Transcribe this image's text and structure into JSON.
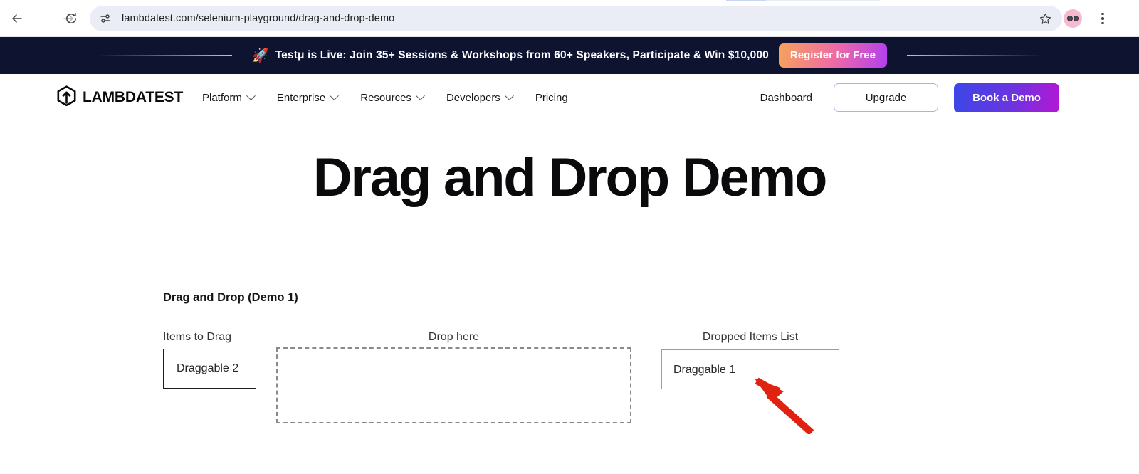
{
  "browser": {
    "back_icon": "arrow-left-icon",
    "forward_icon": "arrow-right-icon",
    "reload_icon": "reload-icon",
    "site_info_icon": "tune-sliders-icon",
    "url": "lambdatest.com/selenium-playground/drag-and-drop-demo",
    "url_placeholder": "Search Google or type a URL",
    "bookmark_icon": "star-icon",
    "avatar_icon": "profile-avatar-icon",
    "menu_icon": "kebab-menu-icon",
    "omnibox_bg": "#eaedf6"
  },
  "promo": {
    "rocket_icon": "rocket-emoji",
    "rocket_glyph": "🚀",
    "text": "Testμ is Live: Join 35+ Sessions & Workshops from 60+ Speakers, Participate & Win $10,000",
    "cta_label": "Register for Free",
    "bg_color": "#0e1430",
    "cta_gradient_from": "#f6a35c",
    "cta_gradient_to": "#b13ff0"
  },
  "header": {
    "logo_icon": "lambdatest-logo-icon",
    "logo_text": "LAMBDATEST",
    "nav": [
      {
        "label": "Platform",
        "has_chevron": true
      },
      {
        "label": "Enterprise",
        "has_chevron": true
      },
      {
        "label": "Resources",
        "has_chevron": true
      },
      {
        "label": "Developers",
        "has_chevron": true
      },
      {
        "label": "Pricing",
        "has_chevron": false
      }
    ],
    "dashboard_label": "Dashboard",
    "upgrade_label": "Upgrade",
    "demo_label": "Book a Demo",
    "upgrade_border_color": "#b9a9f3",
    "demo_gradient_from": "#3b47e8",
    "demo_gradient_to": "#b517d4"
  },
  "page": {
    "title": "Drag and Drop Demo",
    "section_title": "Drag and Drop (Demo 1)",
    "labels": {
      "items_to_drag": "Items to Drag",
      "drop_here": "Drop here",
      "dropped_items_list": "Dropped Items List"
    },
    "draggable_items": [
      {
        "label": "Draggable 2"
      }
    ],
    "dropped_items": [
      {
        "label": "Draggable 1"
      }
    ],
    "annotation": {
      "arrow_icon": "red-arrow-annotation-icon",
      "color": "#e02311"
    }
  }
}
